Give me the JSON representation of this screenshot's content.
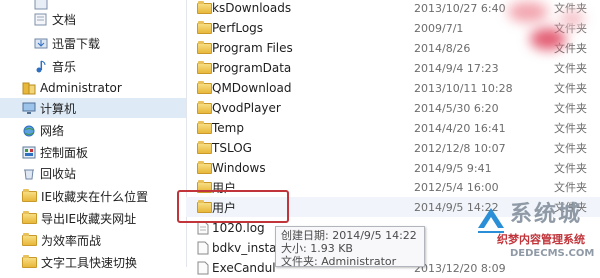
{
  "nav": {
    "items": [
      {
        "label": "",
        "icon": "library-icon"
      },
      {
        "label": "文档",
        "icon": "document-icon"
      },
      {
        "label": "迅雷下载",
        "icon": "download-icon"
      },
      {
        "label": "音乐",
        "icon": "music-icon"
      },
      {
        "label": "Administrator",
        "icon": "user-icon"
      },
      {
        "label": "计算机",
        "icon": "computer-icon",
        "selected": true
      },
      {
        "label": "网络",
        "icon": "network-icon"
      },
      {
        "label": "控制面板",
        "icon": "control-panel-icon"
      },
      {
        "label": "回收站",
        "icon": "recycle-bin-icon"
      },
      {
        "label": "IE收藏夹在什么位置",
        "icon": "folder-icon"
      },
      {
        "label": "导出IE收藏夹网址",
        "icon": "folder-icon"
      },
      {
        "label": "为效率而战",
        "icon": "folder-icon"
      },
      {
        "label": "文字工具快速切换",
        "icon": "folder-icon"
      }
    ]
  },
  "files": [
    {
      "name": "ksDownloads",
      "date": "2013/10/27 6:40",
      "type": "文件夹",
      "icon": "folder-icon"
    },
    {
      "name": "PerfLogs",
      "date": "2009/7/1",
      "type": "文件夹",
      "icon": "folder-icon"
    },
    {
      "name": "Program Files",
      "date": "2014/8/26",
      "type": "文件夹",
      "icon": "folder-icon"
    },
    {
      "name": "ProgramData",
      "date": "2014/9/4 17:23",
      "type": "文件夹",
      "icon": "folder-icon"
    },
    {
      "name": "QMDownload",
      "date": "2013/10/11 10:28",
      "type": "文件夹",
      "icon": "folder-icon"
    },
    {
      "name": "QvodPlayer",
      "date": "2014/5/30 6:20",
      "type": "文件夹",
      "icon": "folder-icon"
    },
    {
      "name": "Temp",
      "date": "2014/4/20 16:41",
      "type": "文件夹",
      "icon": "folder-icon"
    },
    {
      "name": "TSLOG",
      "date": "2012/12/8 10:07",
      "type": "文件夹",
      "icon": "folder-icon"
    },
    {
      "name": "Windows",
      "date": "2014/9/5 9:41",
      "type": "文件夹",
      "icon": "folder-icon"
    },
    {
      "name": "用户",
      "date": "2012/5/4 16:00",
      "type": "文件夹",
      "icon": "folder-icon"
    },
    {
      "name": "用户",
      "date": "2014/9/5 14:22",
      "type": "文件夹",
      "icon": "folder-icon"
    },
    {
      "name": "1020.log",
      "date": "",
      "type": "",
      "icon": "log-file-icon"
    },
    {
      "name": "bdkv_install",
      "date": "",
      "type": "",
      "icon": "file-icon"
    },
    {
      "name": "ExeCandul",
      "date": "2013/12/20 8:09",
      "type": "",
      "icon": "file-icon"
    }
  ],
  "tooltip": {
    "line1": "创建日期: 2014/9/5 14:22",
    "line2": "大小: 1.93 KB",
    "line3": "文件夹: Administrator"
  },
  "watermark": {
    "main": "系统城",
    "sub": "织梦内容管理系统",
    "url": "DEDECMS.COM"
  },
  "colors": {
    "highlight_border": "#c0343a",
    "selection": "#dfeaf7",
    "folder": "#e8b83a"
  }
}
